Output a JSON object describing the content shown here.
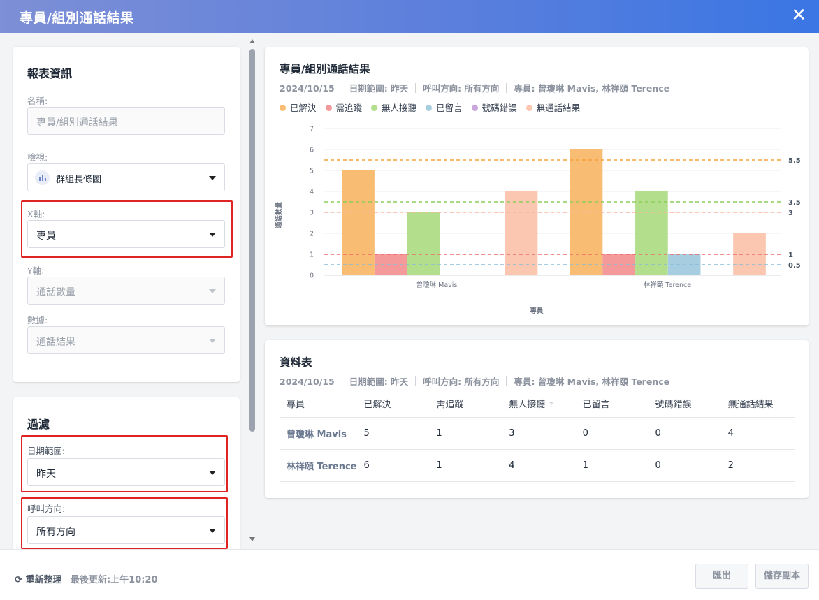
{
  "window": {
    "title": "專員/組別通話結果",
    "close_icon": "close-icon"
  },
  "report_info": {
    "section_title": "報表資訊",
    "name_label": "名稱:",
    "name_value": "專員/組別通話結果",
    "view_label": "檢視:",
    "view_value": "群組長條圖",
    "x_axis_label": "X軸:",
    "x_axis_value": "專員",
    "y_axis_label": "Y軸:",
    "y_axis_value": "通話數量",
    "data_label": "數據:",
    "data_value": "通話結果"
  },
  "filter": {
    "section_title": "過濾",
    "date_range_label": "日期範圍:",
    "date_range_value": "昨天",
    "direction_label": "呼叫方向:",
    "direction_value": "所有方向"
  },
  "meta": {
    "date": "2024/10/15",
    "date_range": "日期範圍: 昨天",
    "direction": "呼叫方向: 所有方向",
    "agents": "專員: 曾瓊琳 Mavis, 林祥頤 Terence"
  },
  "chart_card": {
    "title": "專員/組別通話結果"
  },
  "chart_data": {
    "type": "bar",
    "categories": [
      "曾瓊琳 Mavis",
      "林祥頤 Terence"
    ],
    "series": [
      {
        "name": "已解決",
        "color": "#f8bc72",
        "values": [
          5,
          6
        ],
        "avg": 5.5,
        "avg_color": "#f5a23a"
      },
      {
        "name": "需追蹤",
        "color": "#f59a9a",
        "values": [
          1,
          1
        ],
        "avg": 1,
        "avg_color": "#ee6b6b"
      },
      {
        "name": "無人接聽",
        "color": "#b3de8c",
        "values": [
          3,
          4
        ],
        "avg": 3.5,
        "avg_color": "#8ccf5a"
      },
      {
        "name": "已留言",
        "color": "#a7cde0",
        "values": [
          0,
          1
        ],
        "avg": 0.5,
        "avg_color": "#88bcd8"
      },
      {
        "name": "號碼錯誤",
        "color": "#c9a6dc",
        "values": [
          0,
          0
        ]
      },
      {
        "name": "無通話結果",
        "color": "#fbc7b0",
        "values": [
          4,
          2
        ],
        "avg": 3,
        "avg_color": "#f8b79a"
      }
    ],
    "avg_labels": [
      "5.5",
      "3.5",
      "3",
      "1",
      "0.5"
    ],
    "xlabel": "專員",
    "ylabel": "通話數量",
    "ylim": [
      0,
      7
    ],
    "yticks": [
      "0",
      "1",
      "2",
      "3",
      "4",
      "5",
      "6",
      "7"
    ],
    "grid": true,
    "legend_position": "top-left"
  },
  "table_card": {
    "title": "資料表",
    "headers": [
      "專員",
      "已解決",
      "需追蹤",
      "無人接聽",
      "已留言",
      "號碼錯誤",
      "無通話結果"
    ],
    "rows": [
      [
        "曾瓊琳 Mavis",
        "5",
        "1",
        "3",
        "0",
        "0",
        "4"
      ],
      [
        "林祥頤 Terence",
        "6",
        "1",
        "4",
        "1",
        "0",
        "2"
      ]
    ]
  },
  "footer": {
    "refresh_label": "重新整理",
    "last_updated": "最後更新:上午10:20",
    "export_label": "匯出",
    "save_copy_label": "儲存副本"
  }
}
